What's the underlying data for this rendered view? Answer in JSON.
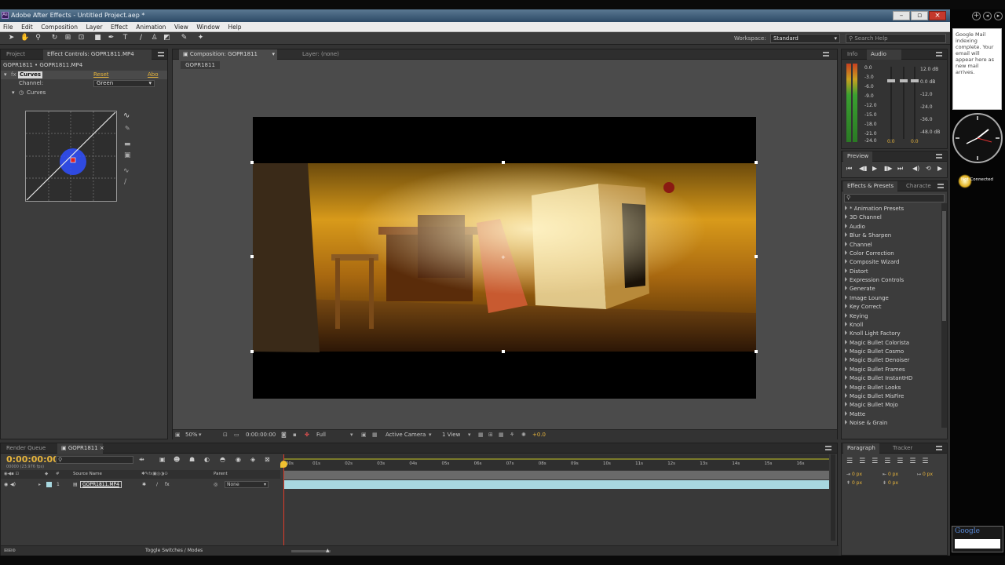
{
  "app": {
    "title": "Adobe After Effects - Untitled Project.aep *",
    "icon_label": "Ae"
  },
  "menu": [
    "File",
    "Edit",
    "Composition",
    "Layer",
    "Effect",
    "Animation",
    "View",
    "Window",
    "Help"
  ],
  "toolbar": {
    "workspace_label": "Workspace:",
    "workspace_value": "Standard",
    "search_placeholder": "Search Help"
  },
  "left_panel": {
    "tabs": [
      "Project",
      "Effect Controls: GOPR1811.MP4"
    ],
    "header": "GOPR1811 • GOPR1811.MP4",
    "effect_name": "Curves",
    "reset": "Reset",
    "about": "Abo",
    "channel_label": "Channel:",
    "channel_value": "Green",
    "curves_label": "Curves"
  },
  "comp_panel": {
    "tab": "Composition: GOPR1811",
    "layer_tab": "Layer: (none)",
    "subtab": "GOPR1811",
    "bottom": {
      "zoom": "50%",
      "timecode": "0:00:00:00",
      "resolution": "Full",
      "camera": "Active Camera",
      "views": "1 View",
      "exposure": "+0.0"
    }
  },
  "info_panel": {
    "tabs": [
      "Info",
      "Audio"
    ],
    "db_left": [
      "0.0",
      "-3.0",
      "-6.0",
      "-9.0",
      "-12.0",
      "-15.0",
      "-18.0",
      "-21.0",
      "-24.0"
    ],
    "db_right": [
      "12.0 dB",
      "0.0 dB",
      "-12.0",
      "-24.0",
      "-36.0",
      "-48.0 dB"
    ],
    "slider_left": "0.0",
    "slider_right": "0.0"
  },
  "preview_panel": {
    "tab": "Preview"
  },
  "effects_panel": {
    "tabs": [
      "Effects & Presets",
      "Characte"
    ],
    "items": [
      "* Animation Presets",
      "3D Channel",
      "Audio",
      "Blur & Sharpen",
      "Channel",
      "Color Correction",
      "Composite Wizard",
      "Distort",
      "Expression Controls",
      "Generate",
      "Image Lounge",
      "Key Correct",
      "Keying",
      "Knoll",
      "Knoll Light Factory",
      "Magic Bullet Colorista",
      "Magic Bullet Cosmo",
      "Magic Bullet Denoiser",
      "Magic Bullet Frames",
      "Magic Bullet InstantHD",
      "Magic Bullet Looks",
      "Magic Bullet MisFire",
      "Magic Bullet Mojo",
      "Matte",
      "Noise & Grain"
    ]
  },
  "paragraph_panel": {
    "tabs": [
      "Paragraph",
      "Tracker"
    ],
    "px": [
      "0 px",
      "0 px",
      "0 px",
      "0 px",
      "0 px"
    ]
  },
  "timeline": {
    "tabs": [
      "Render Queue",
      "GOPR1811"
    ],
    "timecode": "0:00:00:00",
    "fps": "00000 (23.976 fps)",
    "col_source": "Source Name",
    "col_parent": "Parent",
    "layer_num": "1",
    "layer_name": "GOPR1811.MP4",
    "parent_value": "None",
    "ruler": [
      "00s",
      "01s",
      "02s",
      "03s",
      "04s",
      "05s",
      "06s",
      "07s",
      "08s",
      "09s",
      "10s",
      "11s",
      "12s",
      "13s",
      "14s",
      "15s",
      "16s"
    ],
    "toggle": "Toggle Switches / Modes"
  },
  "gadgets": {
    "mail": "Google Mail indexing complete. Your email will appear here as new mail arrives.",
    "not_connected": "Not Connected",
    "google_logo": "Google"
  },
  "colors": {
    "accent": "#e6b43c",
    "layer_bar": "#a8d8e0",
    "playhead": "#e03c2a",
    "curve_point": "#2f4fff"
  }
}
